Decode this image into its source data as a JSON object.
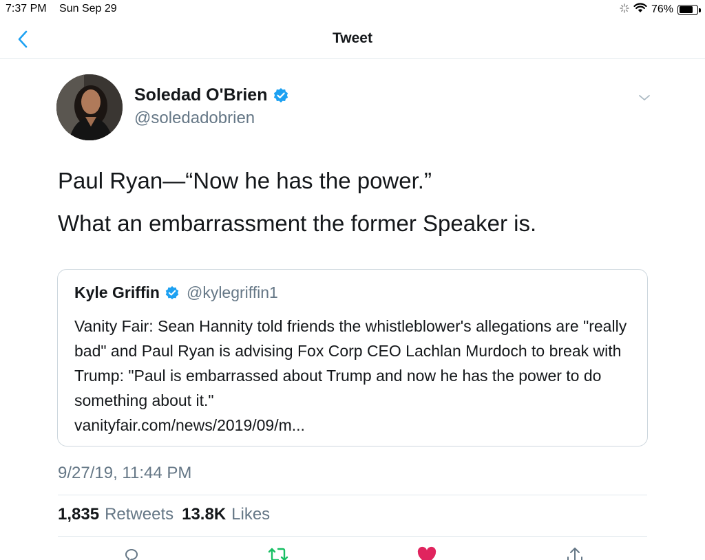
{
  "status_bar": {
    "time": "7:37 PM",
    "date": "Sun Sep 29",
    "battery": "76%",
    "battery_level": 0.76
  },
  "nav": {
    "title": "Tweet"
  },
  "author": {
    "name": "Soledad O'Brien",
    "handle": "@soledadobrien",
    "verified": true
  },
  "tweet": {
    "paragraphs": [
      "Paul Ryan—“Now he has the power.”",
      "What an embarrassment the former Speaker is."
    ]
  },
  "quote": {
    "name": "Kyle Griffin",
    "handle": "@kylegriffin1",
    "text": "Vanity Fair: Sean Hannity told friends the whistleblower's allegations are \"really bad\" and Paul Ryan is advising Fox Corp CEO Lachlan Murdoch to break with Trump: \"Paul is embarrassed about Trump and now he has the power to do something about it.\"",
    "link": "vanityfair.com/news/2019/09/m..."
  },
  "timestamp": "9/27/19, 11:44 PM",
  "stats": {
    "retweets_count": "1,835",
    "retweets_label": "Retweets",
    "likes_count": "13.8K",
    "likes_label": "Likes"
  },
  "colors": {
    "accent": "#1da1f2",
    "retweet": "#17bf63",
    "like": "#e0245e",
    "secondary_text": "#657786"
  },
  "icons": [
    "back-chevron-icon",
    "verified-badge-icon",
    "caret-down-icon",
    "reply-icon",
    "retweet-icon",
    "like-icon",
    "share-icon",
    "wifi-icon",
    "battery-icon"
  ]
}
